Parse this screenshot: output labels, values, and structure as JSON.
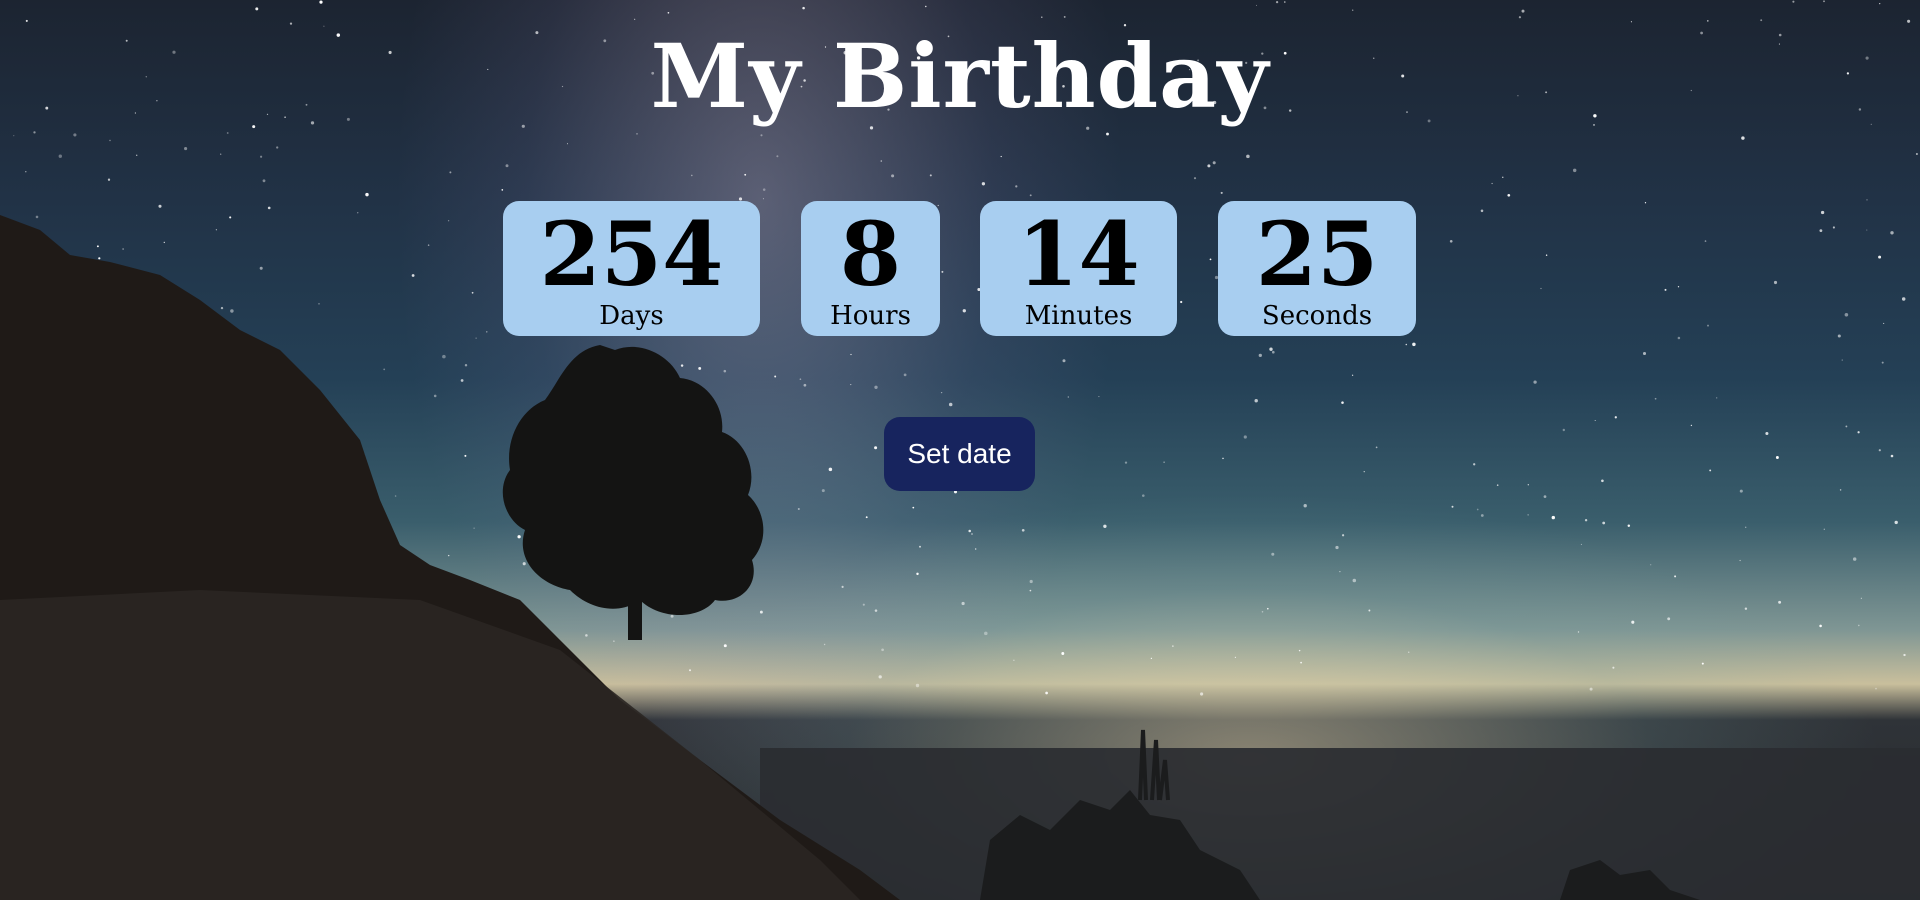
{
  "page": {
    "title": "My Birthday"
  },
  "countdown": {
    "days": {
      "value": "254",
      "label": "Days"
    },
    "hours": {
      "value": "8",
      "label": "Hours"
    },
    "minutes": {
      "value": "14",
      "label": "Minutes"
    },
    "seconds": {
      "value": "25",
      "label": "Seconds"
    }
  },
  "actions": {
    "set_date_label": "Set date"
  },
  "colors": {
    "box_background": "#a8cef0",
    "button_background": "#17245e",
    "title_text": "#ffffff"
  }
}
